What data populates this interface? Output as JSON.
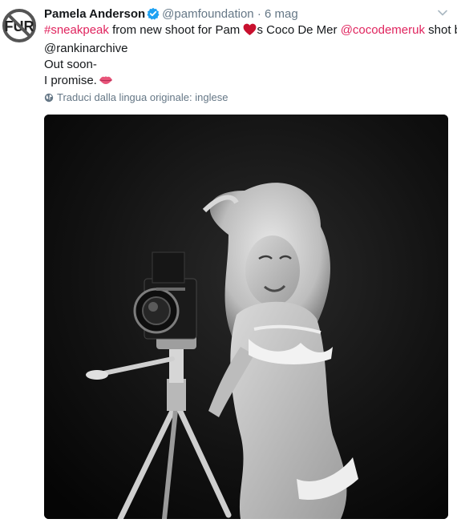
{
  "tweet": {
    "author_name": "Pamela Anderson",
    "handle": "@pamfoundation",
    "separator": "·",
    "date": "6 mag",
    "avatar_text": "FUR",
    "text": {
      "hashtag": "#sneakpeak",
      "part1": " from new shoot for Pam ",
      "part2": "s Coco De Mer ",
      "mention1": "@cocodemeruk",
      "part3": " shot by",
      "mention2": "@rankinarchive",
      "line3": "Out soon-",
      "line4": "I promise."
    },
    "translate_label": "Traduci dalla lingua originale: inglese",
    "icons": {
      "verified": "verified-badge-icon",
      "caret": "chevron-down-icon",
      "heart": "red-heart-emoji",
      "lips": "kiss-mark-emoji",
      "globe": "globe-icon"
    },
    "colors": {
      "link": "#e0245e",
      "verified": "#1da1f2",
      "muted": "#657786"
    }
  }
}
